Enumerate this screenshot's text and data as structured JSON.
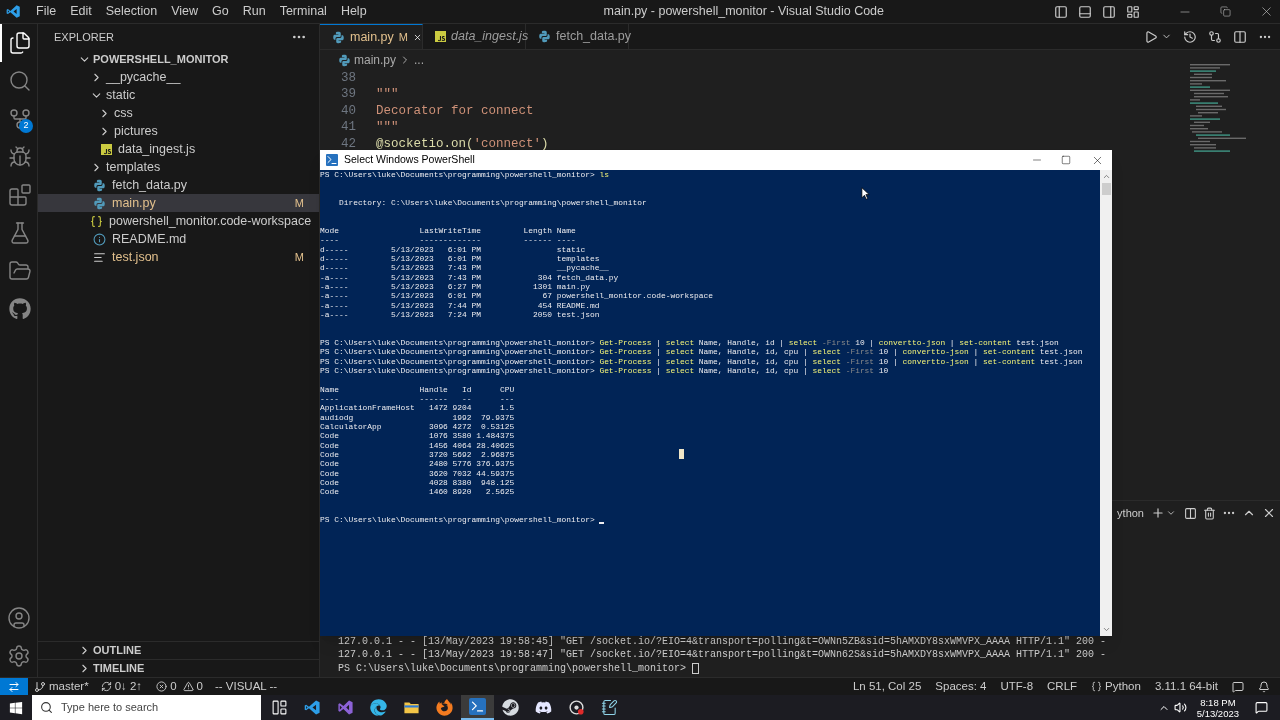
{
  "window": {
    "title": "main.py - powershell_monitor - Visual Studio Code",
    "menu": [
      "File",
      "Edit",
      "Selection",
      "View",
      "Go",
      "Run",
      "Terminal",
      "Help"
    ]
  },
  "activity_bar": {
    "items": [
      {
        "kind": "explorer",
        "selected": true
      },
      {
        "kind": "search",
        "selected": false
      },
      {
        "kind": "source_control",
        "selected": false,
        "badge": "2"
      },
      {
        "kind": "run_debug",
        "selected": false
      },
      {
        "kind": "extensions",
        "selected": false
      },
      {
        "kind": "testing",
        "selected": false
      },
      {
        "kind": "folder",
        "selected": false
      },
      {
        "kind": "github",
        "selected": false
      }
    ],
    "bottom": [
      {
        "kind": "account"
      },
      {
        "kind": "settings"
      }
    ]
  },
  "sidebar": {
    "title": "EXPLORER",
    "section": "POWERSHELL_MONITOR",
    "items": [
      {
        "label": "__pycache__",
        "kind": "folder",
        "expanded": false,
        "selected": false
      },
      {
        "label": "static",
        "kind": "folder",
        "expanded": true,
        "selected": false,
        "children": [
          {
            "label": "css",
            "kind": "folder",
            "expanded": false,
            "selected": false
          },
          {
            "label": "pictures",
            "kind": "folder",
            "expanded": false,
            "selected": false
          },
          {
            "label": "data_ingest.js",
            "kind": "js",
            "selected": false
          }
        ]
      },
      {
        "label": "templates",
        "kind": "folder",
        "expanded": false,
        "selected": false
      },
      {
        "label": "fetch_data.py",
        "kind": "python",
        "selected": false
      },
      {
        "label": "main.py",
        "kind": "python",
        "selected": true,
        "badge": "M"
      },
      {
        "label": "powershell_monitor.code-workspace",
        "kind": "workspace",
        "selected": false
      },
      {
        "label": "README.md",
        "kind": "info",
        "selected": false
      },
      {
        "label": "test.json",
        "kind": "text",
        "selected": false,
        "badge": "M"
      }
    ],
    "collapsed_sections": [
      "OUTLINE",
      "TIMELINE"
    ]
  },
  "editor": {
    "tabs": [
      {
        "label": "main.py",
        "kind": "python",
        "badge": "M",
        "selected": true,
        "preview": false
      },
      {
        "label": "data_ingest.js",
        "kind": "js",
        "selected": false,
        "preview": true
      },
      {
        "label": "fetch_data.py",
        "kind": "python",
        "selected": false,
        "preview": false
      }
    ],
    "breadcrumb": [
      "main.py",
      "..."
    ],
    "lines": [
      {
        "number": "38"
      },
      {
        "number": "39",
        "tokens": [
          {
            "text": "\"\"\"",
            "kind": "string"
          }
        ]
      },
      {
        "number": "40",
        "tokens": [
          {
            "text": "Decorator for connect",
            "kind": "string"
          }
        ]
      },
      {
        "number": "41",
        "tokens": [
          {
            "text": "\"\"\"",
            "kind": "string"
          }
        ]
      },
      {
        "number": "42",
        "tokens": [
          {
            "text": "@socketio.on(",
            "kind": "decorator"
          },
          {
            "text": "'connect'",
            "kind": "string"
          },
          {
            "text": ")",
            "kind": "decorator"
          }
        ]
      }
    ]
  },
  "panel": {
    "terminal_name": "ython",
    "lines": [
      "127.0.0.1 - - [13/May/2023 19:58:45] \"GET /socket.io/?EIO=4&transport=polling&t=OWNn5ZB&sid=5hAMXDY8sxWMVPX_AAAA HTTP/1.1\" 200 -",
      "127.0.0.1 - - [13/May/2023 19:58:47] \"GET /socket.io/?EIO=4&transport=polling&t=OWNn62S&sid=5hAMXDY8sxWMVPX_AAAA HTTP/1.1\" 200 -",
      "PS C:\\Users\\luke\\Documents\\programming\\powershell_monitor>"
    ]
  },
  "powershell": {
    "title": "Select Windows PowerShell",
    "blocks": [
      {
        "kind": "commands",
        "lines": [
          {
            "prompt": "PS C:\\Users\\luke\\Documents\\programming\\powershell_monitor>",
            "segments": [
              {
                "text": "ls",
                "kind": "cmdlet"
              }
            ]
          }
        ]
      },
      {
        "kind": "output",
        "lines": [
          "    Directory: C:\\Users\\luke\\Documents\\programming\\powershell_monitor"
        ]
      },
      {
        "kind": "output",
        "lines": [
          "Mode                 LastWriteTime         Length Name",
          "----                 -------------         ------ ----",
          "d-----         5/13/2023   6:01 PM                static",
          "d-----         5/13/2023   6:01 PM                templates",
          "d-----         5/13/2023   7:43 PM                __pycache__",
          "-a----         5/13/2023   7:43 PM            304 fetch_data.py",
          "-a----         5/13/2023   6:27 PM           1301 main.py",
          "-a----         5/13/2023   6:01 PM             67 powershell_monitor.code-workspace",
          "-a----         5/13/2023   7:44 PM            454 README.md",
          "-a----         5/13/2023   7:24 PM           2050 test.json"
        ]
      },
      {
        "kind": "commands",
        "lines": [
          {
            "prompt": "PS C:\\Users\\luke\\Documents\\programming\\powershell_monitor>",
            "segments": [
              {
                "text": "Get-Process",
                "kind": "cmdlet"
              },
              {
                "text": " | ",
                "kind": "plain"
              },
              {
                "text": "select",
                "kind": "cmdlet"
              },
              {
                "text": " Name, Handle, id | ",
                "kind": "plain"
              },
              {
                "text": "select",
                "kind": "cmdlet"
              },
              {
                "text": " -First",
                "kind": "param"
              },
              {
                "text": " 10 | ",
                "kind": "plain"
              },
              {
                "text": "convertto-json",
                "kind": "cmdlet"
              },
              {
                "text": " | ",
                "kind": "plain"
              },
              {
                "text": "set-content",
                "kind": "cmdlet"
              },
              {
                "text": " test.json",
                "kind": "plain"
              }
            ]
          },
          {
            "prompt": "PS C:\\Users\\luke\\Documents\\programming\\powershell_monitor>",
            "segments": [
              {
                "text": "Get-Process",
                "kind": "cmdlet"
              },
              {
                "text": " | ",
                "kind": "plain"
              },
              {
                "text": "select",
                "kind": "cmdlet"
              },
              {
                "text": " Name, Handle, id, cpu | ",
                "kind": "plain"
              },
              {
                "text": "select",
                "kind": "cmdlet"
              },
              {
                "text": " -First",
                "kind": "param"
              },
              {
                "text": " 10 | ",
                "kind": "plain"
              },
              {
                "text": "convertto-json",
                "kind": "cmdlet"
              },
              {
                "text": " | ",
                "kind": "plain"
              },
              {
                "text": "set-content",
                "kind": "cmdlet"
              },
              {
                "text": " test.json",
                "kind": "plain"
              }
            ]
          },
          {
            "prompt": "PS C:\\Users\\luke\\Documents\\programming\\powershell_monitor>",
            "segments": [
              {
                "text": "Get-Process",
                "kind": "cmdlet"
              },
              {
                "text": " | ",
                "kind": "plain"
              },
              {
                "text": "select",
                "kind": "cmdlet"
              },
              {
                "text": " Name, Handle, id, cpu | ",
                "kind": "plain"
              },
              {
                "text": "select",
                "kind": "cmdlet"
              },
              {
                "text": " -First",
                "kind": "param"
              },
              {
                "text": " 10 | ",
                "kind": "plain"
              },
              {
                "text": "convertto-json",
                "kind": "cmdlet"
              },
              {
                "text": " | ",
                "kind": "plain"
              },
              {
                "text": "set-content",
                "kind": "cmdlet"
              },
              {
                "text": " test.json",
                "kind": "plain"
              }
            ]
          },
          {
            "prompt": "PS C:\\Users\\luke\\Documents\\programming\\powershell_monitor>",
            "segments": [
              {
                "text": "Get-Process",
                "kind": "cmdlet"
              },
              {
                "text": " | ",
                "kind": "plain"
              },
              {
                "text": "select",
                "kind": "cmdlet"
              },
              {
                "text": " Name, Handle, id, cpu | ",
                "kind": "plain"
              },
              {
                "text": "select",
                "kind": "cmdlet"
              },
              {
                "text": " -First",
                "kind": "param"
              },
              {
                "text": " 10",
                "kind": "plain"
              }
            ]
          }
        ]
      },
      {
        "kind": "process_table",
        "lines": [
          "Name                 Handle   Id      CPU",
          "----                 ------   --      ---",
          "ApplicationFrameHost   1472 9204      1.5",
          "audiodg                     1992  79.9375",
          "CalculatorApp          3096 4272  0.53125",
          "Code                   1076 3580 1.484375",
          "Code                   1456 4064 28.40625",
          "Code                   3720 5692  2.96875",
          "Code                   2480 5776 376.9375",
          "Code                   3620 7032 44.59375",
          "Code                   4028 8380  948.125",
          "Code                   1460 8920   2.5625"
        ]
      },
      {
        "kind": "prompt",
        "lines": [
          {
            "prompt": "PS C:\\Users\\luke\\Documents\\programming\\powershell_monitor>"
          }
        ]
      }
    ]
  },
  "status_bar": {
    "branch": "master*",
    "sync": "0↓ 2↑",
    "errors": "0",
    "warnings": "0",
    "mode": "-- VISUAL --",
    "right": [
      {
        "kind": "text",
        "text": "Ln 51, Col 25"
      },
      {
        "kind": "text",
        "text": "Spaces: 4"
      },
      {
        "kind": "text",
        "text": "UTF-8"
      },
      {
        "kind": "text",
        "text": "CRLF"
      },
      {
        "kind": "language",
        "text": "Python"
      },
      {
        "kind": "text",
        "text": "3.11.1 64-bit"
      }
    ]
  },
  "taskbar": {
    "search_placeholder": "Type here to search",
    "apps": [
      {
        "kind": "task_view",
        "selected": false
      },
      {
        "kind": "editor",
        "selected": false
      },
      {
        "kind": "ide",
        "selected": false
      },
      {
        "kind": "browser",
        "selected": false
      },
      {
        "kind": "files",
        "selected": false
      },
      {
        "kind": "firefox",
        "selected": false
      },
      {
        "kind": "terminal",
        "selected": true
      },
      {
        "kind": "store",
        "selected": false
      },
      {
        "kind": "chat",
        "selected": false
      },
      {
        "kind": "recorder",
        "selected": false
      },
      {
        "kind": "notes",
        "selected": false
      }
    ],
    "time": "8:18 PM",
    "date": "5/13/2023"
  }
}
